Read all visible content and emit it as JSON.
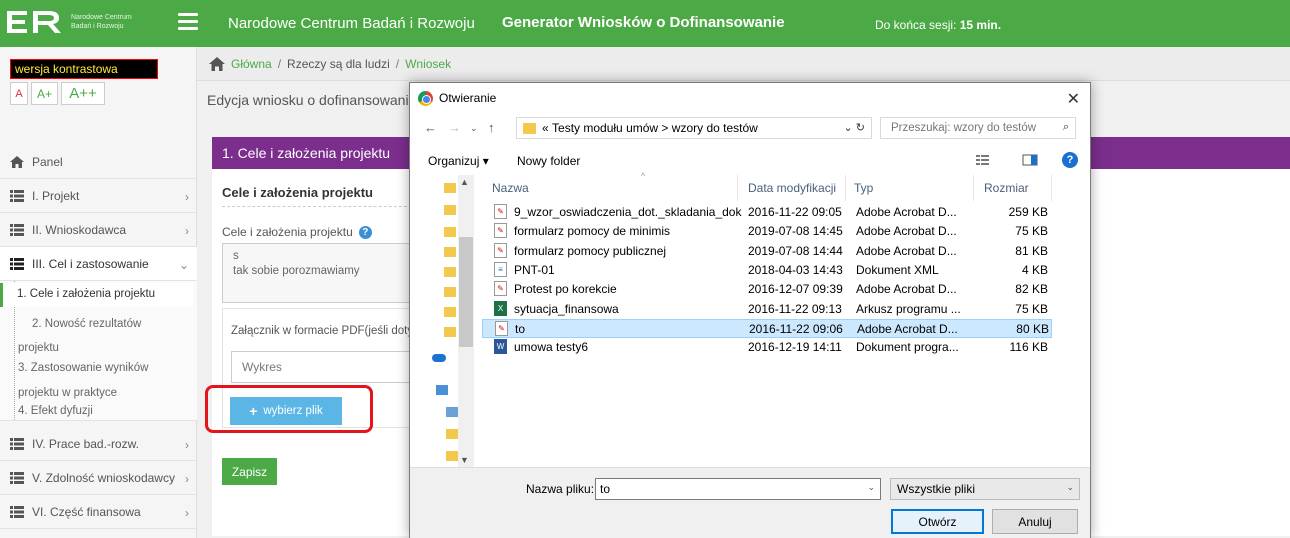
{
  "header": {
    "logo_line1": "Narodowe Centrum",
    "logo_line2": "Badań i Rozwoju",
    "title": "Narodowe Centrum Badań i Rozwoju",
    "generator": "Generator Wniosków o Dofinansowanie",
    "session_label": "Do końca sesji:",
    "session_value": "15 min."
  },
  "accessibility": {
    "contrast": "wersja kontrastowa",
    "size_small": "A",
    "size_medium": "A+",
    "size_large": "A++"
  },
  "breadcrumb": {
    "home": "Główna",
    "sep": "/",
    "project": "Rzeczy są dla ludzi",
    "current": "Wniosek"
  },
  "sidebar": {
    "panel": "Panel",
    "items": [
      {
        "label": "I. Projekt"
      },
      {
        "label": "II. Wnioskodawca"
      },
      {
        "label": "III. Cel i zastosowanie"
      }
    ],
    "sub_items": [
      "1. Cele i założenia projektu",
      "2. Nowość rezultatów",
      "projektu",
      "3. Zastosowanie wyników",
      "projektu w praktyce",
      "4. Efekt dyfuzji"
    ],
    "items_after": [
      {
        "label": "IV. Prace bad.-rozw."
      },
      {
        "label": "V. Zdolność wnioskodawcy"
      },
      {
        "label": "VI. Część finansowa"
      }
    ]
  },
  "main": {
    "edit_title": "Edycja wniosku o dofinansowani",
    "section_title": "1. Cele i założenia projektu",
    "panel_title": "Cele i założenia projektu",
    "field_label": "Cele i założenia projektu",
    "help": "?",
    "textarea_line1": "s",
    "textarea_line2": "tak sobie porozmawiamy",
    "attach_label": "Załącznik w formacie PDF(jeśli doty",
    "attach_value": "Wykres",
    "choose_file": "wybierz plik",
    "save": "Zapisz"
  },
  "dialog": {
    "title": "Otwieranie",
    "path_prefix": "«",
    "path_folder1": "Testy modułu umów",
    "path_sep": ">",
    "path_folder2": "wzory do testów",
    "search_placeholder": "Przeszukaj: wzory do testów",
    "organize": "Organizuj",
    "new_folder": "Nowy folder",
    "help": "?",
    "columns": {
      "name": "Nazwa",
      "date": "Data modyfikacji",
      "type": "Typ",
      "size": "Rozmiar"
    },
    "files": [
      {
        "name": "9_wzor_oswiadczenia_dot._skladania_dok...",
        "date": "2016-11-22 09:05",
        "type": "Adobe Acrobat D...",
        "size": "259 KB",
        "icon": "pdf"
      },
      {
        "name": "formularz pomocy de minimis",
        "date": "2019-07-08 14:45",
        "type": "Adobe Acrobat D...",
        "size": "75 KB",
        "icon": "pdf"
      },
      {
        "name": "formularz pomocy publicznej",
        "date": "2019-07-08 14:44",
        "type": "Adobe Acrobat D...",
        "size": "81 KB",
        "icon": "pdf"
      },
      {
        "name": "PNT-01",
        "date": "2018-04-03 14:43",
        "type": "Dokument XML",
        "size": "4 KB",
        "icon": "xml"
      },
      {
        "name": "Protest po korekcie",
        "date": "2016-12-07 09:39",
        "type": "Adobe Acrobat D...",
        "size": "82 KB",
        "icon": "pdf"
      },
      {
        "name": "sytuacja_finansowa",
        "date": "2016-11-22 09:13",
        "type": "Arkusz programu ...",
        "size": "75 KB",
        "icon": "xls"
      },
      {
        "name": "to",
        "date": "2016-11-22 09:06",
        "type": "Adobe Acrobat D...",
        "size": "80 KB",
        "icon": "pdf"
      },
      {
        "name": "umowa testy6",
        "date": "2016-12-19 14:11",
        "type": "Dokument progra...",
        "size": "116 KB",
        "icon": "doc"
      }
    ],
    "filename_label": "Nazwa pliku:",
    "filename_value": "to",
    "filter": "Wszystkie pliki",
    "open": "Otwórz",
    "cancel": "Anuluj"
  },
  "colors": {
    "brand_green": "#4caa46",
    "section_purple": "#7b2e8c",
    "button_blue": "#5bb6e6",
    "highlight_red": "#e4141b",
    "selection_blue": "#cce8ff"
  }
}
